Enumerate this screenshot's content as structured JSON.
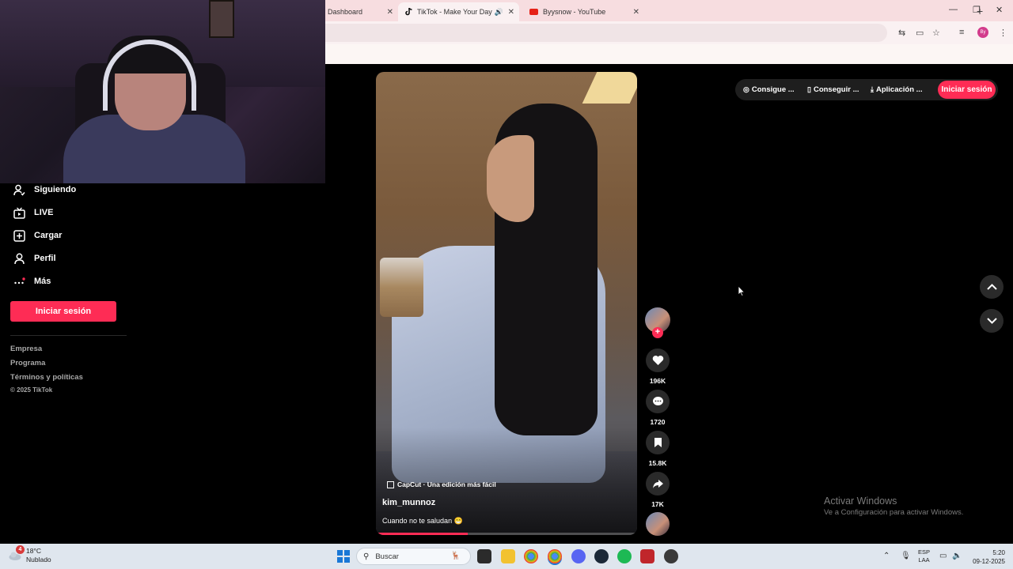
{
  "browser": {
    "tabs": [
      {
        "title": "Dashboard",
        "active": false
      },
      {
        "title": "TikTok - Make Your Day",
        "active": true
      },
      {
        "title": "Byysnow - YouTube",
        "active": false
      }
    ],
    "new_tab_glyph": "+",
    "window_controls": [
      "—",
      "❐",
      "✕"
    ],
    "profile_initials": "By"
  },
  "sidebar": {
    "items": [
      {
        "label": "Siguiendo",
        "icon": "following-icon"
      },
      {
        "label": "LIVE",
        "icon": "live-icon"
      },
      {
        "label": "Cargar",
        "icon": "upload-icon"
      },
      {
        "label": "Perfil",
        "icon": "profile-icon"
      },
      {
        "label": "Más",
        "icon": "more-icon"
      }
    ],
    "login_label": "Iniciar sesión",
    "footer_links": [
      "Empresa",
      "Programa",
      "Términos y políticas"
    ],
    "copyright": "© 2025 TikTok"
  },
  "video": {
    "capcut_label": "CapCut · Una edición más fácil",
    "username": "kim_munnoz",
    "caption": "Cuando no te saludan 😁",
    "progress": 0.35
  },
  "actions": {
    "likes": "196K",
    "comments": "1720",
    "saves": "15.8K",
    "shares": "17K"
  },
  "topbar": {
    "coins_label": "Consigue ...",
    "app_label": "Conseguir ...",
    "download_label": "Aplicación ...",
    "login_label": "Iniciar sesión"
  },
  "watermark": {
    "line1": "Activar Windows",
    "line2": "Ve a Configuración para activar Windows."
  },
  "taskbar": {
    "weather_badge": "4",
    "temperature": "18°C",
    "condition": "Nublado",
    "search_placeholder": "Buscar",
    "lang_top": "ESP",
    "lang_bottom": "LAA",
    "time": "5:20",
    "date": "09-12-2025"
  },
  "colors": {
    "accent": "#fe2c55",
    "background": "#000000",
    "tabbar": "#f7dde0"
  }
}
